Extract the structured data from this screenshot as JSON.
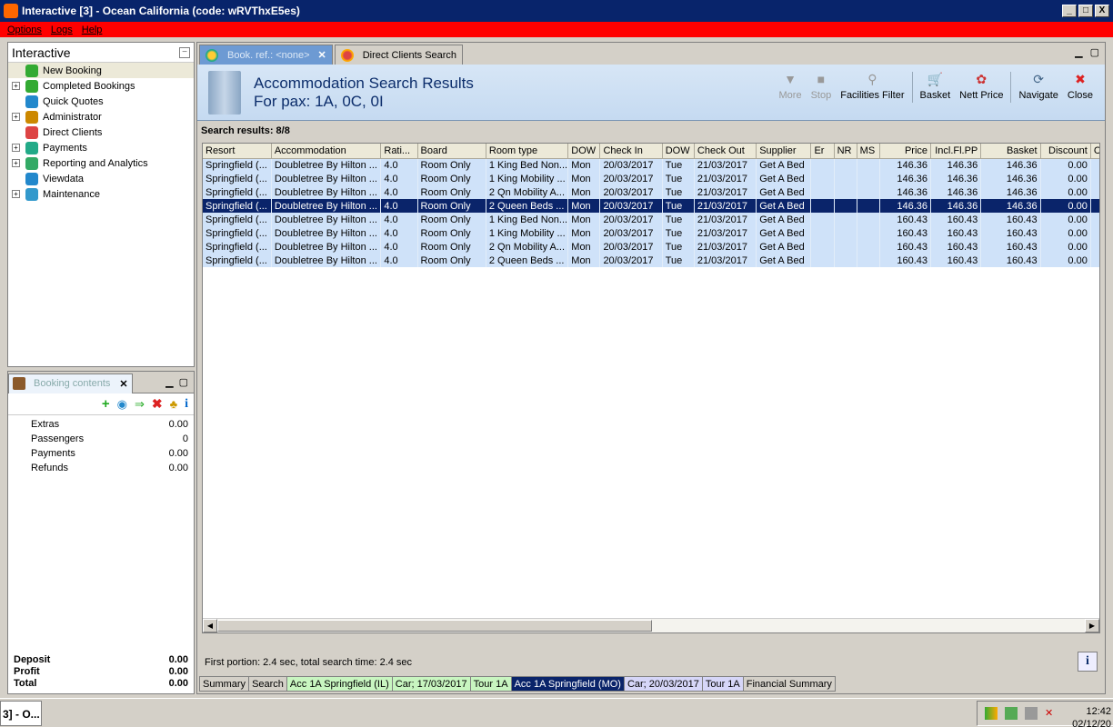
{
  "window": {
    "title": "Interactive [3] - Ocean California (code: wRVThxE5es)",
    "buttons": [
      "_",
      "□",
      "X"
    ]
  },
  "menu": [
    "Options",
    "Logs",
    "Help"
  ],
  "nav": {
    "title": "Interactive",
    "items": [
      {
        "label": "New Booking",
        "expandable": false,
        "icon": "palm-tree-icon"
      },
      {
        "label": "Completed Bookings",
        "expandable": true,
        "icon": "palm-tree-icon"
      },
      {
        "label": "Quick Quotes",
        "expandable": false,
        "icon": "globe-icon"
      },
      {
        "label": "Administrator",
        "expandable": true,
        "icon": "person-icon"
      },
      {
        "label": "Direct Clients",
        "expandable": false,
        "icon": "client-icon"
      },
      {
        "label": "Payments",
        "expandable": true,
        "icon": "payment-icon"
      },
      {
        "label": "Reporting and Analytics",
        "expandable": true,
        "icon": "report-icon"
      },
      {
        "label": "Viewdata",
        "expandable": false,
        "icon": "globe-icon"
      },
      {
        "label": "Maintenance",
        "expandable": true,
        "icon": "maintenance-icon"
      }
    ]
  },
  "booking_contents": {
    "tab_label": "Booking contents",
    "rows": [
      {
        "label": "Extras",
        "value": "0.00"
      },
      {
        "label": "Passengers",
        "value": "0"
      },
      {
        "label": "Payments",
        "value": "0.00"
      },
      {
        "label": "Refunds",
        "value": "0.00"
      }
    ],
    "footer": [
      {
        "label": "Deposit",
        "value": "0.00"
      },
      {
        "label": "Profit",
        "value": "0.00"
      },
      {
        "label": "Total",
        "value": "0.00"
      }
    ]
  },
  "tabs": [
    {
      "label": "Book. ref.: <none>",
      "active": true
    },
    {
      "label": "Direct Clients Search",
      "active": false
    }
  ],
  "header": {
    "title": "Accommodation Search Results",
    "subtitle": "For pax: 1A, 0C, 0I"
  },
  "toolbar": [
    {
      "label": "More",
      "icon": "▼",
      "disabled": true
    },
    {
      "label": "Stop",
      "icon": "■",
      "disabled": true
    },
    {
      "label": "Facilities Filter",
      "icon": "⚲",
      "disabled": false
    },
    {
      "label": "Basket",
      "icon": "🛒",
      "disabled": false
    },
    {
      "label": "Nett Price",
      "icon": "✿",
      "disabled": false
    },
    {
      "label": "Navigate",
      "icon": "⟳",
      "disabled": false
    },
    {
      "label": "Close",
      "icon": "✖",
      "disabled": false
    }
  ],
  "results": {
    "label": "Search results: 8/8",
    "columns": [
      "Resort",
      "Accommodation",
      "Rati...",
      "Board",
      "Room type",
      "DOW",
      "Check In",
      "DOW",
      "Check Out",
      "Supplier",
      "Er",
      "NR",
      "MS",
      "Price",
      "Incl.Fl.PP",
      "Basket",
      "Discount",
      "C"
    ],
    "rows": [
      [
        "Springfield (...",
        "Doubletree By Hilton ...",
        "4.0",
        "Room Only",
        "1 King Bed Non...",
        "Mon",
        "20/03/2017",
        "Tue",
        "21/03/2017",
        "Get A Bed",
        "",
        "",
        "",
        "146.36",
        "146.36",
        "146.36",
        "0.00",
        ""
      ],
      [
        "Springfield (...",
        "Doubletree By Hilton ...",
        "4.0",
        "Room Only",
        "1 King Mobility ...",
        "Mon",
        "20/03/2017",
        "Tue",
        "21/03/2017",
        "Get A Bed",
        "",
        "",
        "",
        "146.36",
        "146.36",
        "146.36",
        "0.00",
        ""
      ],
      [
        "Springfield (...",
        "Doubletree By Hilton ...",
        "4.0",
        "Room Only",
        "2 Qn Mobility A...",
        "Mon",
        "20/03/2017",
        "Tue",
        "21/03/2017",
        "Get A Bed",
        "",
        "",
        "",
        "146.36",
        "146.36",
        "146.36",
        "0.00",
        ""
      ],
      [
        "Springfield (...",
        "Doubletree By Hilton ...",
        "4.0",
        "Room Only",
        "2 Queen Beds ...",
        "Mon",
        "20/03/2017",
        "Tue",
        "21/03/2017",
        "Get A Bed",
        "",
        "",
        "",
        "146.36",
        "146.36",
        "146.36",
        "0.00",
        ""
      ],
      [
        "Springfield (...",
        "Doubletree By Hilton ...",
        "4.0",
        "Room Only",
        "1 King Bed Non...",
        "Mon",
        "20/03/2017",
        "Tue",
        "21/03/2017",
        "Get A Bed",
        "",
        "",
        "",
        "160.43",
        "160.43",
        "160.43",
        "0.00",
        ""
      ],
      [
        "Springfield (...",
        "Doubletree By Hilton ...",
        "4.0",
        "Room Only",
        "1 King Mobility ...",
        "Mon",
        "20/03/2017",
        "Tue",
        "21/03/2017",
        "Get A Bed",
        "",
        "",
        "",
        "160.43",
        "160.43",
        "160.43",
        "0.00",
        ""
      ],
      [
        "Springfield (...",
        "Doubletree By Hilton ...",
        "4.0",
        "Room Only",
        "2 Qn Mobility A...",
        "Mon",
        "20/03/2017",
        "Tue",
        "21/03/2017",
        "Get A Bed",
        "",
        "",
        "",
        "160.43",
        "160.43",
        "160.43",
        "0.00",
        ""
      ],
      [
        "Springfield (...",
        "Doubletree By Hilton ...",
        "4.0",
        "Room Only",
        "2 Queen Beds ...",
        "Mon",
        "20/03/2017",
        "Tue",
        "21/03/2017",
        "Get A Bed",
        "",
        "",
        "",
        "160.43",
        "160.43",
        "160.43",
        "0.00",
        ""
      ]
    ],
    "selected_row": 3
  },
  "status": "First portion: 2.4 sec, total search time: 2.4 sec",
  "info_button": "i",
  "bottom_tabs": [
    {
      "label": "Summary",
      "style": "plain"
    },
    {
      "label": "Search",
      "style": "plain"
    },
    {
      "label": "Acc 1A Springfield (IL)",
      "style": "green"
    },
    {
      "label": "Car; 17/03/2017",
      "style": "green"
    },
    {
      "label": "Tour 1A",
      "style": "green"
    },
    {
      "label": "Acc 1A Springfield (MO)",
      "style": "active"
    },
    {
      "label": "Car; 20/03/2017",
      "style": "blue"
    },
    {
      "label": "Tour 1A",
      "style": "blue"
    },
    {
      "label": "Financial Summary",
      "style": "plain"
    }
  ],
  "taskbar": {
    "item": "3] - O...",
    "clock_time": "12:42",
    "clock_date": "02/12/20"
  }
}
